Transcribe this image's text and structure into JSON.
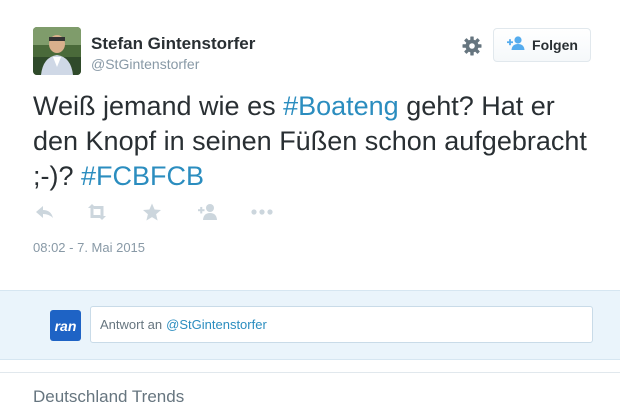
{
  "tweet": {
    "fullname": "Stefan Gintenstorfer",
    "handle": "@StGintenstorfer",
    "follow_label": "Folgen",
    "text_before": "Weiß jemand wie es ",
    "hashtag_1": "#Boateng",
    "text_middle": " geht? Hat er den Knopf in seinen Füßen schon aufgebracht ;-)? ",
    "hashtag_2": "#FCBFCB",
    "timestamp": "08:02 - 7. Mai 2015"
  },
  "reply": {
    "logo_text": "ran",
    "placeholder_prefix": "Antwort an",
    "placeholder_mention": "@StGintenstorfer"
  },
  "trends": {
    "title": "Deutschland Trends"
  },
  "icons": {
    "reply": "reply-icon",
    "retweet": "retweet-icon",
    "favorite": "star-icon",
    "follow": "add-user-icon",
    "more": "more-dots-icon",
    "settings": "gear-icon"
  },
  "colors": {
    "link": "#2b8dbf",
    "text": "#292f33",
    "muted": "#8899a6",
    "reply_bg": "#eaf4fb",
    "ran_logo": "#1e63c5"
  }
}
